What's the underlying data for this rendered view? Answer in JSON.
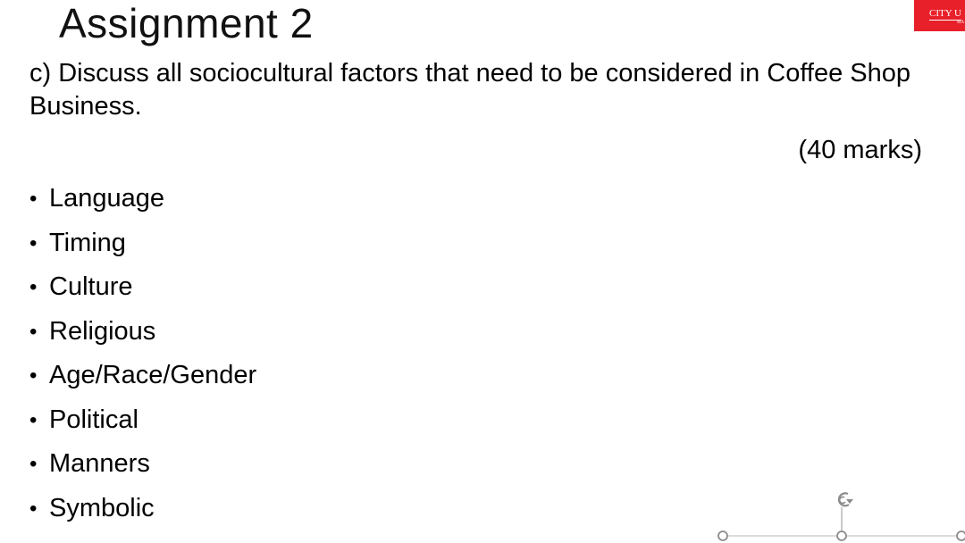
{
  "slide": {
    "title": "Assignment 2",
    "question": "c) Discuss all sociocultural factors that need to be considered in Coffee Shop Business.",
    "marks": "(40 marks)",
    "bullet_glyph": "•",
    "bullets": [
      "Language",
      "Timing",
      "Culture",
      "Religious",
      "Age/Race/Gender",
      "Political",
      "Manners",
      "Symbolic"
    ]
  },
  "logo": {
    "line1": "CITY U",
    "line2": "MA",
    "color": "#e8202a"
  },
  "selection": {
    "handle_color": "#8c8c8c",
    "rotate_icon": "rotate-handle-icon"
  }
}
